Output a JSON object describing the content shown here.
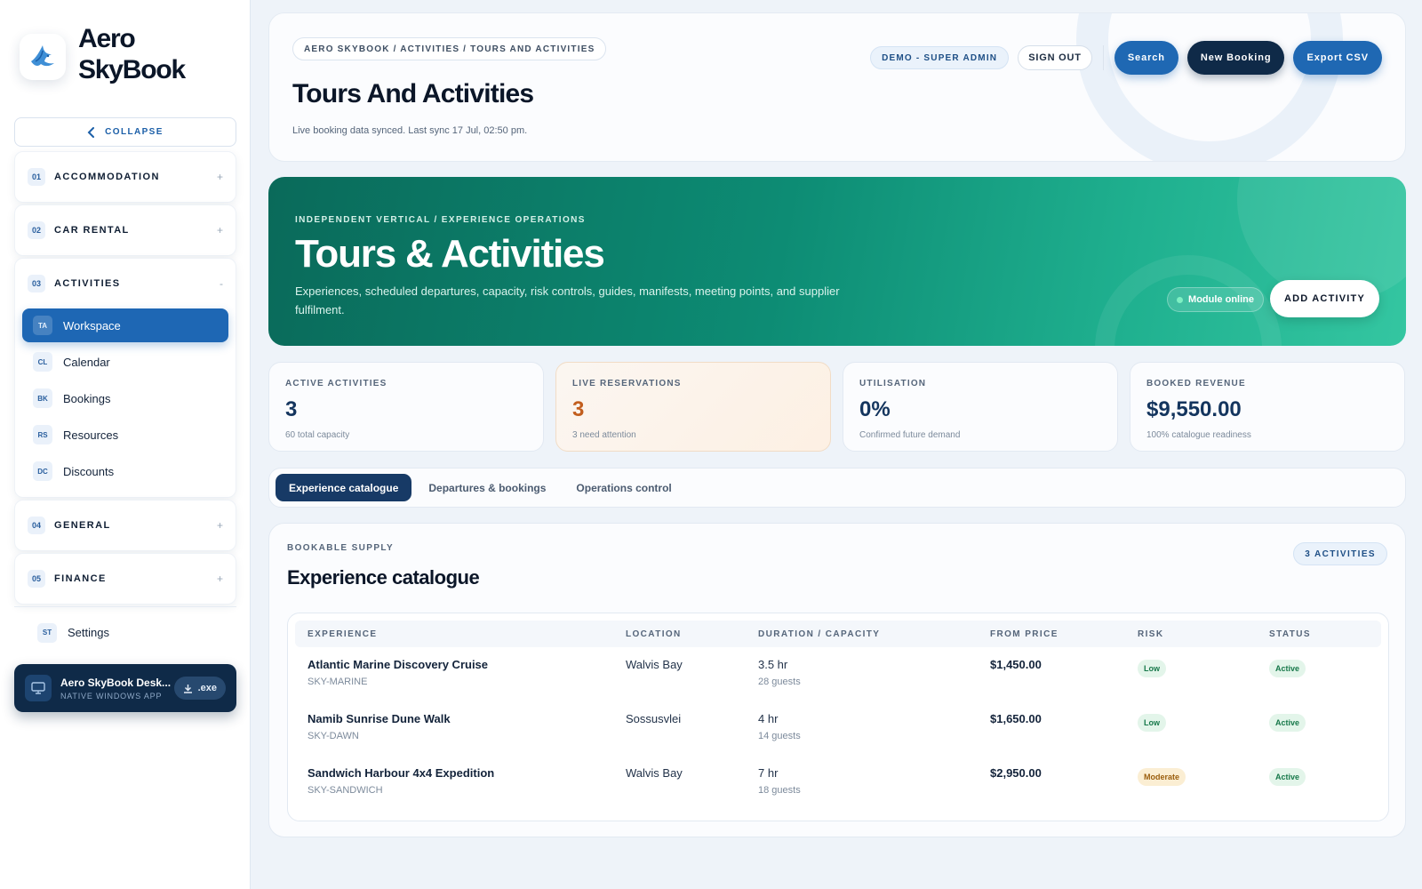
{
  "brand": {
    "name": "Aero SkyBook"
  },
  "sidebar": {
    "collapse_label": "COLLAPSE",
    "sections": [
      {
        "num": "01",
        "label": "ACCOMMODATION",
        "toggle": "+"
      },
      {
        "num": "02",
        "label": "CAR RENTAL",
        "toggle": "+"
      },
      {
        "num": "03",
        "label": "ACTIVITIES",
        "toggle": "-"
      },
      {
        "num": "04",
        "label": "GENERAL",
        "toggle": "+"
      },
      {
        "num": "05",
        "label": "FINANCE",
        "toggle": "+"
      }
    ],
    "activities_items": [
      {
        "code": "TA",
        "label": "Workspace"
      },
      {
        "code": "CL",
        "label": "Calendar"
      },
      {
        "code": "BK",
        "label": "Bookings"
      },
      {
        "code": "RS",
        "label": "Resources"
      },
      {
        "code": "DC",
        "label": "Discounts"
      }
    ],
    "settings": {
      "code": "ST",
      "label": "Settings"
    },
    "desktop": {
      "title": "Aero SkyBook Desk...",
      "subtitle": "NATIVE WINDOWS APP",
      "button": ".exe"
    }
  },
  "header": {
    "breadcrumb": "AERO SKYBOOK / ACTIVITIES / TOURS AND ACTIVITIES",
    "title": "Tours And Activities",
    "sync": "Live booking data synced. Last sync 17 Jul, 02:50 pm.",
    "role": "DEMO - SUPER ADMIN",
    "signout": "SIGN OUT",
    "search": "Search",
    "new_booking": "New Booking",
    "export": "Export CSV"
  },
  "hero": {
    "kicker": "INDEPENDENT VERTICAL / EXPERIENCE OPERATIONS",
    "title": "Tours & Activities",
    "description": "Experiences, scheduled departures, capacity, risk controls, guides, manifests, meeting points, and supplier fulfilment.",
    "status": "Module online",
    "button": "ADD ACTIVITY"
  },
  "stats": [
    {
      "label": "ACTIVE ACTIVITIES",
      "value": "3",
      "sub": "60 total capacity"
    },
    {
      "label": "LIVE RESERVATIONS",
      "value": "3",
      "sub": "3 need attention"
    },
    {
      "label": "UTILISATION",
      "value": "0%",
      "sub": "Confirmed future demand"
    },
    {
      "label": "BOOKED REVENUE",
      "value": "$9,550.00",
      "sub": "100% catalogue readiness"
    }
  ],
  "tabs": [
    "Experience catalogue",
    "Departures & bookings",
    "Operations control"
  ],
  "catalogue": {
    "kicker": "BOOKABLE SUPPLY",
    "title": "Experience catalogue",
    "count": "3 ACTIVITIES",
    "columns": [
      "EXPERIENCE",
      "LOCATION",
      "DURATION / CAPACITY",
      "FROM PRICE",
      "RISK",
      "STATUS"
    ],
    "rows": [
      {
        "name": "Atlantic Marine Discovery Cruise",
        "code": "SKY-MARINE",
        "location": "Walvis Bay",
        "duration": "3.5 hr",
        "capacity": "28 guests",
        "price": "$1,450.00",
        "risk": "Low",
        "status": "Active"
      },
      {
        "name": "Namib Sunrise Dune Walk",
        "code": "SKY-DAWN",
        "location": "Sossusvlei",
        "duration": "4 hr",
        "capacity": "14 guests",
        "price": "$1,650.00",
        "risk": "Low",
        "status": "Active"
      },
      {
        "name": "Sandwich Harbour 4x4 Expedition",
        "code": "SKY-SANDWICH",
        "location": "Walvis Bay",
        "duration": "7 hr",
        "capacity": "18 guests",
        "price": "$2,950.00",
        "risk": "Moderate",
        "status": "Active"
      }
    ]
  }
}
